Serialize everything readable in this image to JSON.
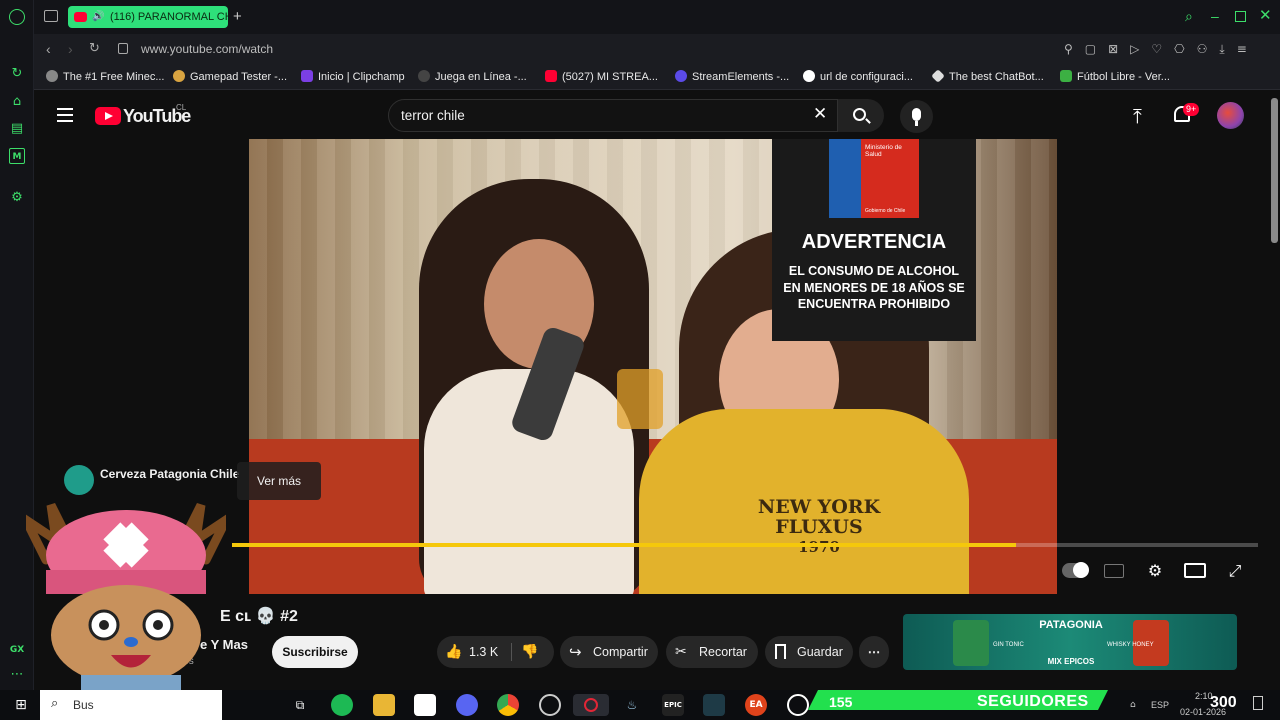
{
  "browser": {
    "tab_title": "(116) PARANORMAL CH",
    "url": "www.youtube.com/watch",
    "bookmarks": [
      "The #1 Free Minec...",
      "Gamepad Tester -...",
      "Inicio | Clipchamp",
      "Juega en Línea -...",
      "(5027) MI STREA...",
      "StreamElements -...",
      "url de configuraci...",
      "The best ChatBot...",
      "Fútbol Libre - Ver..."
    ]
  },
  "yt": {
    "logo": "YouTube",
    "region": "CL",
    "search_value": "terror chile",
    "notif_count": "9+"
  },
  "ad": {
    "advertiser": "Cerveza Patagonia Chile",
    "cta": "Ver más",
    "ministry_line1": "Ministerio de",
    "ministry_line2": "Salud",
    "gov": "Gobierno de Chile",
    "warning_title": "ADVERTENCIA",
    "warning_text": "EL CONSUMO DE ALCOHOL EN MENORES DE 18 AÑOS SE ENCUENTRA PROHIBIDO",
    "shirt_line1": "NEW YORK",
    "shirt_line2": "FLUXUS",
    "shirt_line3": "1970",
    "progress_fraction": 0.764
  },
  "video": {
    "title_partial": "E ᴄʟ 💀 #2",
    "channel_partial": "e Y Mas",
    "subs_partial": "ptores",
    "subscribe": "Suscribirse",
    "likes": "1.3 K",
    "share": "Compartir",
    "clip": "Recortar",
    "save": "Guardar"
  },
  "side_ad": {
    "brand": "PATAGONIA",
    "sub": "MIX EPICOS",
    "label1": "GIN TONIC",
    "label2": "WHISKY HONEY"
  },
  "overlay": {
    "follow_count": "155",
    "follow_label": "SEGUIDORES",
    "goal": "300",
    "date": "02-01-2026",
    "time": "2:10",
    "lang": "ESP"
  },
  "taskbar": {
    "search_partial": "Bus"
  },
  "colors": {
    "accent": "#2ee07a",
    "yt_red": "#ff0033",
    "progress": "#f5c80b"
  }
}
